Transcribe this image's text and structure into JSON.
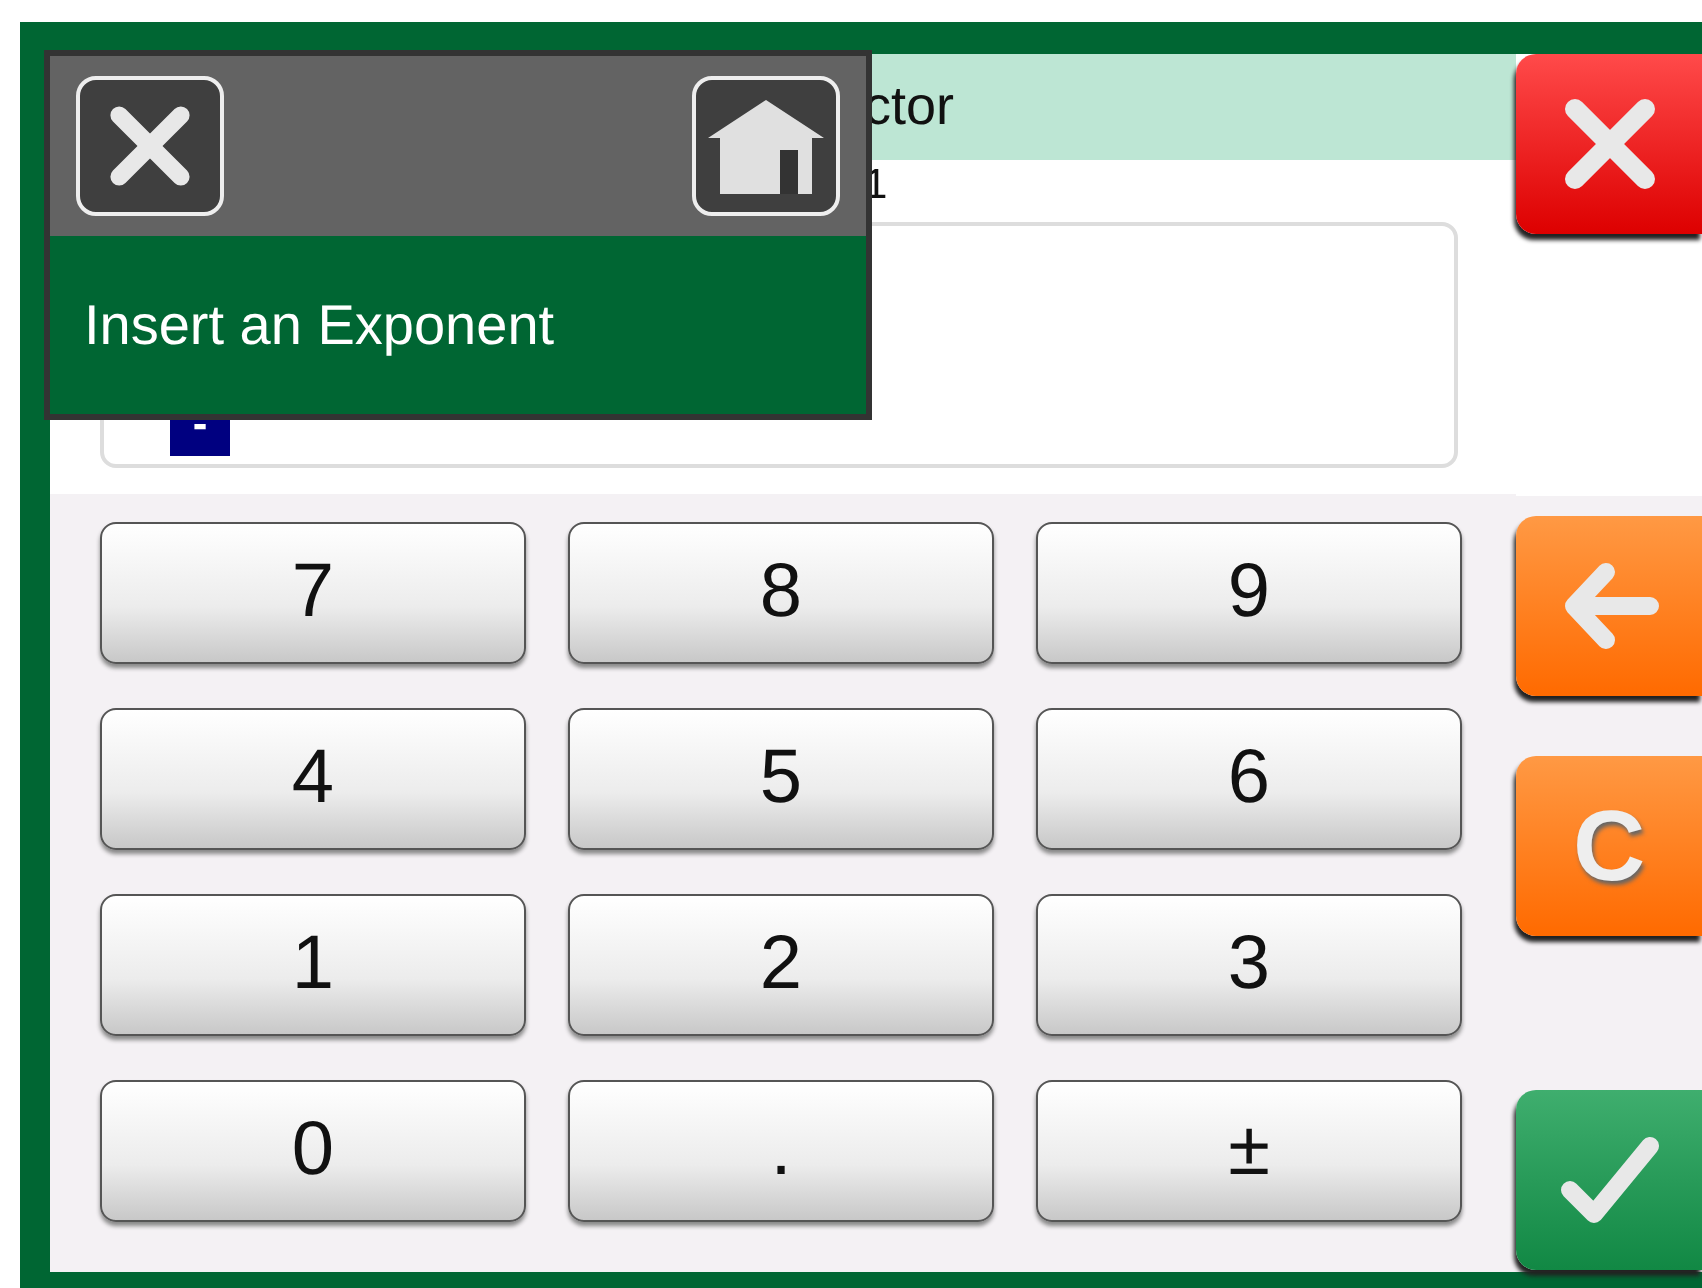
{
  "header": {
    "title": "ctor",
    "subtitle": "1"
  },
  "field": {
    "value": "-"
  },
  "keypad": [
    {
      "label": "7"
    },
    {
      "label": "8"
    },
    {
      "label": "9"
    },
    {
      "label": "4"
    },
    {
      "label": "5"
    },
    {
      "label": "6"
    },
    {
      "label": "1"
    },
    {
      "label": "2"
    },
    {
      "label": "3"
    },
    {
      "label": "0"
    },
    {
      "label": "."
    },
    {
      "label": "±"
    }
  ],
  "side_buttons": [
    {
      "kind": "cancel"
    },
    {
      "kind": "backspace"
    },
    {
      "kind": "clear",
      "label": "C"
    },
    {
      "kind": "accept"
    }
  ],
  "popup": {
    "message": "Insert an Exponent"
  }
}
